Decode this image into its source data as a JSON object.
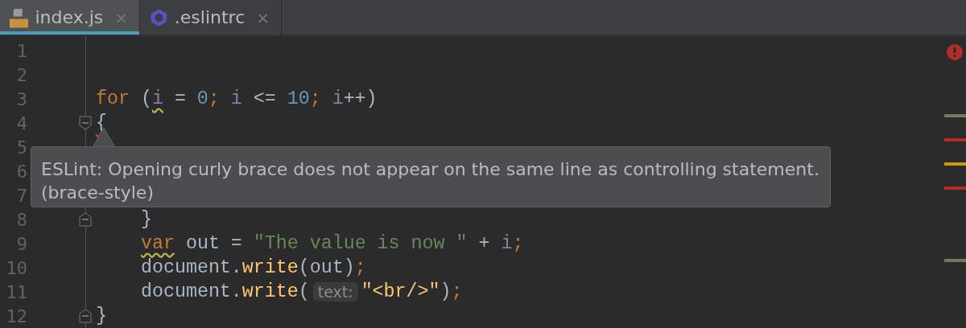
{
  "tabs": [
    {
      "label": "index.js",
      "close": "×",
      "selected": true
    },
    {
      "label": ".eslintrc",
      "close": "×",
      "selected": false
    }
  ],
  "editor": {
    "lines": [
      {
        "number": "1"
      },
      {
        "number": "2"
      },
      {
        "number": "3",
        "tokens": [
          {
            "kind": "keyword",
            "text": "for"
          },
          {
            "kind": "plain",
            "text": " ("
          },
          {
            "kind": "variable",
            "text": "i",
            "warning": true
          },
          {
            "kind": "plain",
            "text": " = "
          },
          {
            "kind": "number",
            "text": "0"
          },
          {
            "kind": "keyword",
            "text": "; "
          },
          {
            "kind": "variable",
            "text": "i"
          },
          {
            "kind": "plain",
            "text": " <= "
          },
          {
            "kind": "number",
            "text": "10"
          },
          {
            "kind": "keyword",
            "text": "; "
          },
          {
            "kind": "variable",
            "text": "i"
          },
          {
            "kind": "plain",
            "text": "++)"
          }
        ]
      },
      {
        "number": "4",
        "fold_start": true,
        "tokens": [
          {
            "kind": "plain",
            "text": "{",
            "error": true
          }
        ]
      },
      {
        "number": "5"
      },
      {
        "number": "6"
      },
      {
        "number": "7"
      },
      {
        "number": "8",
        "fold_end": true,
        "indented": true,
        "tokens": [
          {
            "kind": "plain",
            "text": "}"
          }
        ]
      },
      {
        "number": "9",
        "indented": true,
        "tokens": [
          {
            "kind": "keyword",
            "text": "var",
            "warning": true
          },
          {
            "kind": "plain",
            "text": " out = "
          },
          {
            "kind": "string",
            "text": "\"The value is now \""
          },
          {
            "kind": "plain",
            "text": " + "
          },
          {
            "kind": "variable",
            "text": "i"
          },
          {
            "kind": "keyword",
            "text": ";"
          }
        ]
      },
      {
        "number": "10",
        "indented": true,
        "tokens": [
          {
            "kind": "plain",
            "text": "document."
          },
          {
            "kind": "function",
            "text": "write"
          },
          {
            "kind": "plain",
            "text": "(out)"
          },
          {
            "kind": "keyword",
            "text": ";"
          }
        ]
      },
      {
        "number": "11",
        "indented": true,
        "tokens": [
          {
            "kind": "plain",
            "text": "document."
          },
          {
            "kind": "function",
            "text": "write"
          },
          {
            "kind": "plain",
            "text": "("
          },
          {
            "kind": "hint",
            "text": "text:"
          },
          {
            "kind": "function",
            "text": "\"<br/>\""
          },
          {
            "kind": "plain",
            "text": ")"
          },
          {
            "kind": "keyword",
            "text": ";"
          }
        ]
      },
      {
        "number": "12",
        "fold_end": true,
        "tokens": [
          {
            "kind": "plain",
            "text": "}"
          }
        ]
      }
    ],
    "tooltip": "ESLint: Opening curly brace does not appear on the same line as controlling statement. (brace-style)",
    "markers": [
      {
        "color": "#7d7464"
      },
      {
        "color": "#b42b29"
      },
      {
        "color": "#c89a1c"
      },
      {
        "color": "#b42b29"
      },
      {
        "color": "#7d7464"
      }
    ]
  }
}
